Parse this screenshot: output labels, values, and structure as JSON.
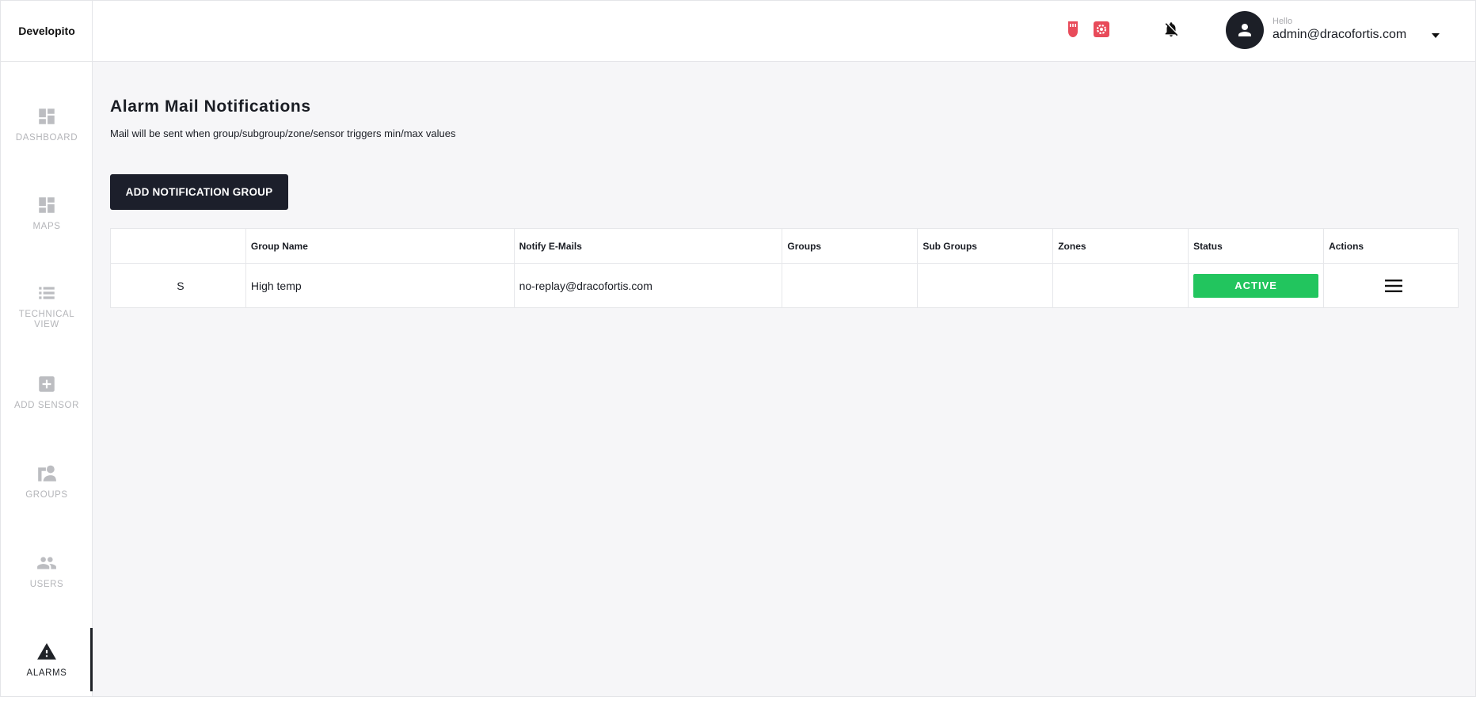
{
  "app": {
    "brand": "Developito"
  },
  "sidebar": {
    "items": [
      {
        "label": "DASHBOARD",
        "icon": "dashboard-icon"
      },
      {
        "label": "MAPS",
        "icon": "maps-icon"
      },
      {
        "label": "TECHNICAL VIEW",
        "icon": "technical-view-icon"
      },
      {
        "label": "ADD SENSOR",
        "icon": "add-sensor-icon"
      },
      {
        "label": "GROUPS",
        "icon": "groups-icon"
      },
      {
        "label": "USERS",
        "icon": "users-icon"
      },
      {
        "label": "ALARMS",
        "icon": "alarms-icon",
        "active": true
      }
    ]
  },
  "header": {
    "hello": "Hello",
    "user_email": "admin@dracofortis.com",
    "icons": [
      "sensor-status-icon",
      "settings-alert-icon",
      "notifications-off-icon",
      "account-icon",
      "caret-down-icon"
    ],
    "alert_color": "#e84b5a"
  },
  "main": {
    "title": "Alarm Mail Notifications",
    "subtitle": "Mail will be sent when group/subgroup/zone/sensor triggers min/max values",
    "add_button": "ADD NOTIFICATION GROUP",
    "table": {
      "headers": [
        "",
        "Group Name",
        "Notify E-Mails",
        "Groups",
        "Sub Groups",
        "Zones",
        "Status",
        "Actions"
      ],
      "rows": [
        {
          "initial": "S",
          "group_name": "High temp",
          "emails": "no-replay@dracofortis.com",
          "groups": "",
          "sub_groups": "",
          "zones": "",
          "status": "ACTIVE",
          "status_color": "#22c55e"
        }
      ]
    }
  }
}
